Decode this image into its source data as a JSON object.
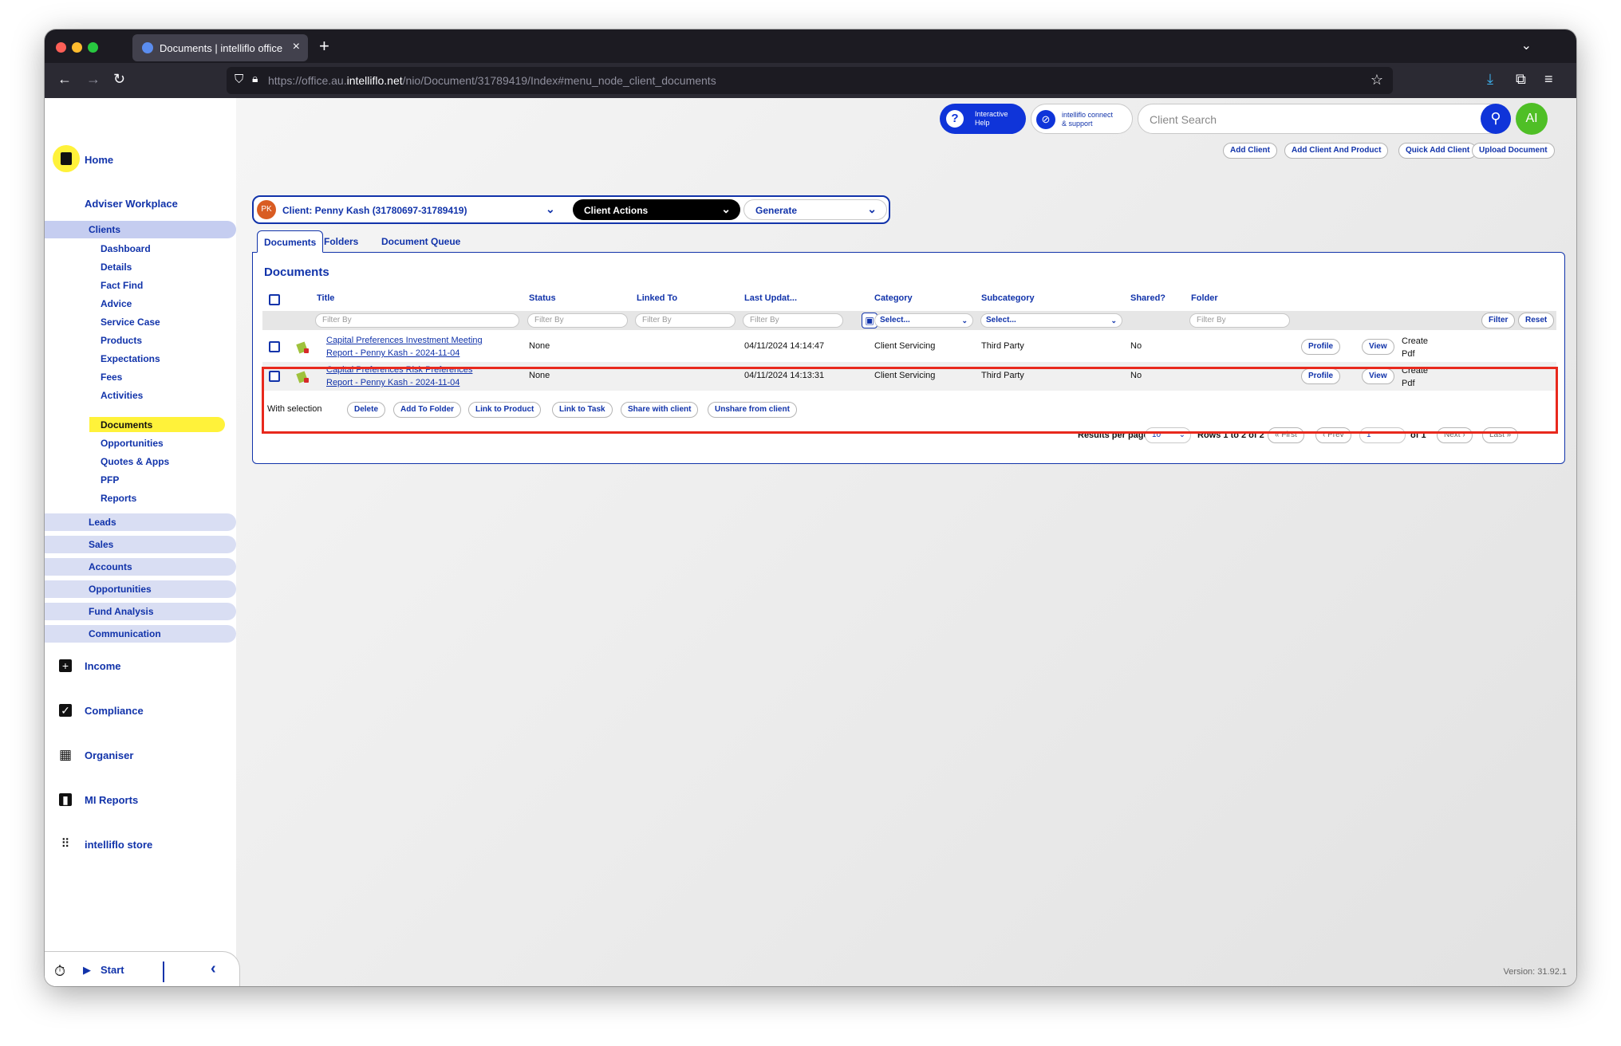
{
  "browser": {
    "tab_title": "Documents | intelliflo office",
    "tab_close": "×",
    "new_tab": "+",
    "url_prefix": "https://office.au.",
    "url_domain": "intelliflo.net",
    "url_path": "/nio/Document/31789419/Index#menu_node_client_documents"
  },
  "sidebar": {
    "home": "Home",
    "adviser_workplace": "Adviser Workplace",
    "clients": "Clients",
    "client_items": [
      "Dashboard",
      "Details",
      "Fact Find",
      "Advice",
      "Service Case",
      "Products",
      "Expectations",
      "Fees",
      "Activities",
      "Documents",
      "Opportunities",
      "Quotes & Apps",
      "PFP",
      "Reports"
    ],
    "groups": [
      "Leads",
      "Sales",
      "Accounts",
      "Opportunities",
      "Fund Analysis",
      "Communication"
    ],
    "income": "Income",
    "compliance": "Compliance",
    "organiser": "Organiser",
    "mi_reports": "MI Reports",
    "store": "intelliflo store",
    "start": "Start"
  },
  "topbar": {
    "help_line1": "Interactive",
    "help_line2": "Help",
    "connect_line1": "intelliflo connect",
    "connect_line2": "& support",
    "search_placeholder": "Client Search",
    "avatar_initials": "AI",
    "quick_buttons": [
      "Add Client",
      "Add Client And Product",
      "Quick Add Client",
      "Upload Document"
    ]
  },
  "client_bar": {
    "initials": "PK",
    "client_label": "Client: Penny Kash (31780697-31789419)",
    "actions_label": "Client Actions",
    "generate_label": "Generate"
  },
  "tabs": [
    "Documents",
    "Folders",
    "Document Queue"
  ],
  "documents": {
    "heading": "Documents",
    "columns": [
      "Title",
      "Status",
      "Linked To",
      "Last Updat...",
      "Category",
      "Subcategory",
      "Shared?",
      "Folder"
    ],
    "filter_placeholder": "Filter By",
    "select_placeholder": "Select...",
    "filter_button": "Filter",
    "reset_button": "Reset",
    "rows": [
      {
        "title_line1": "Capital Preferences Investment Meeting",
        "title_line2": "Report - Penny Kash - 2024-11-04",
        "status": "None",
        "updated": "04/11/2024 14:14:47",
        "category": "Client Servicing",
        "subcategory": "Third Party",
        "shared": "No",
        "profile": "Profile",
        "view": "View",
        "create_line1": "Create",
        "create_line2": "Pdf"
      },
      {
        "title_line1": "Capital Preferences Risk Preferences",
        "title_line2": "Report - Penny Kash - 2024-11-04",
        "status": "None",
        "updated": "04/11/2024 14:13:31",
        "category": "Client Servicing",
        "subcategory": "Third Party",
        "shared": "No",
        "profile": "Profile",
        "view": "View",
        "create_line1": "Create",
        "create_line2": "Pdf"
      }
    ],
    "with_selection": "With selection",
    "bulk_actions": [
      "Delete",
      "Add To Folder",
      "Link to Product",
      "Link to Task",
      "Share with client",
      "Unshare from client"
    ],
    "results_per_page_label": "Results per page",
    "results_per_page": "10",
    "rows_info": "Rows 1 to 2 of 2",
    "first": "« First",
    "prev": "‹ Prev",
    "page": "1",
    "of_pages": "of 1",
    "next": "Next ›",
    "last": "Last »"
  },
  "version": "Version: 31.92.1",
  "colors": {
    "brand_blue": "#1133aa",
    "accent_yellow": "#fff23a",
    "highlight_red": "#e8291d"
  }
}
